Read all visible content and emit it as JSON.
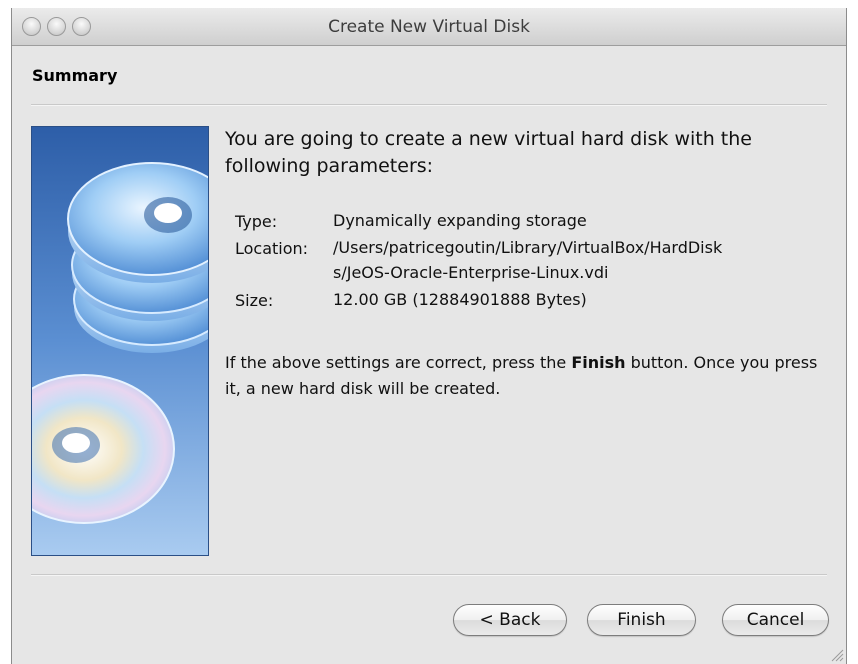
{
  "window": {
    "title": "Create New Virtual Disk"
  },
  "page": {
    "heading": "Summary"
  },
  "summary": {
    "intro": "You are going to create a new virtual hard disk with the following parameters:",
    "params": [
      {
        "label": "Type:",
        "value": [
          "Dynamically expanding storage"
        ]
      },
      {
        "label": "Location:",
        "value": [
          "/Users/patricegoutin/Library/VirtualBox/HardDisk",
          "s/JeOS-Oracle-Enterprise-Linux.vdi"
        ]
      },
      {
        "label": "Size:",
        "value": [
          "12.00 GB (12884901888 Bytes)"
        ]
      }
    ],
    "note_before": "If the above settings are correct, press the ",
    "note_bold": "Finish",
    "note_after": " button. Once you press it, a new hard disk will be created."
  },
  "buttons": {
    "back": "< Back",
    "finish": "Finish",
    "cancel": "Cancel"
  },
  "icons": {
    "close": "close-icon",
    "minimize": "minimize-icon",
    "zoom": "zoom-icon",
    "sidebar": "hard-disk-stack-illustration",
    "grip": "resize-grip-icon"
  }
}
